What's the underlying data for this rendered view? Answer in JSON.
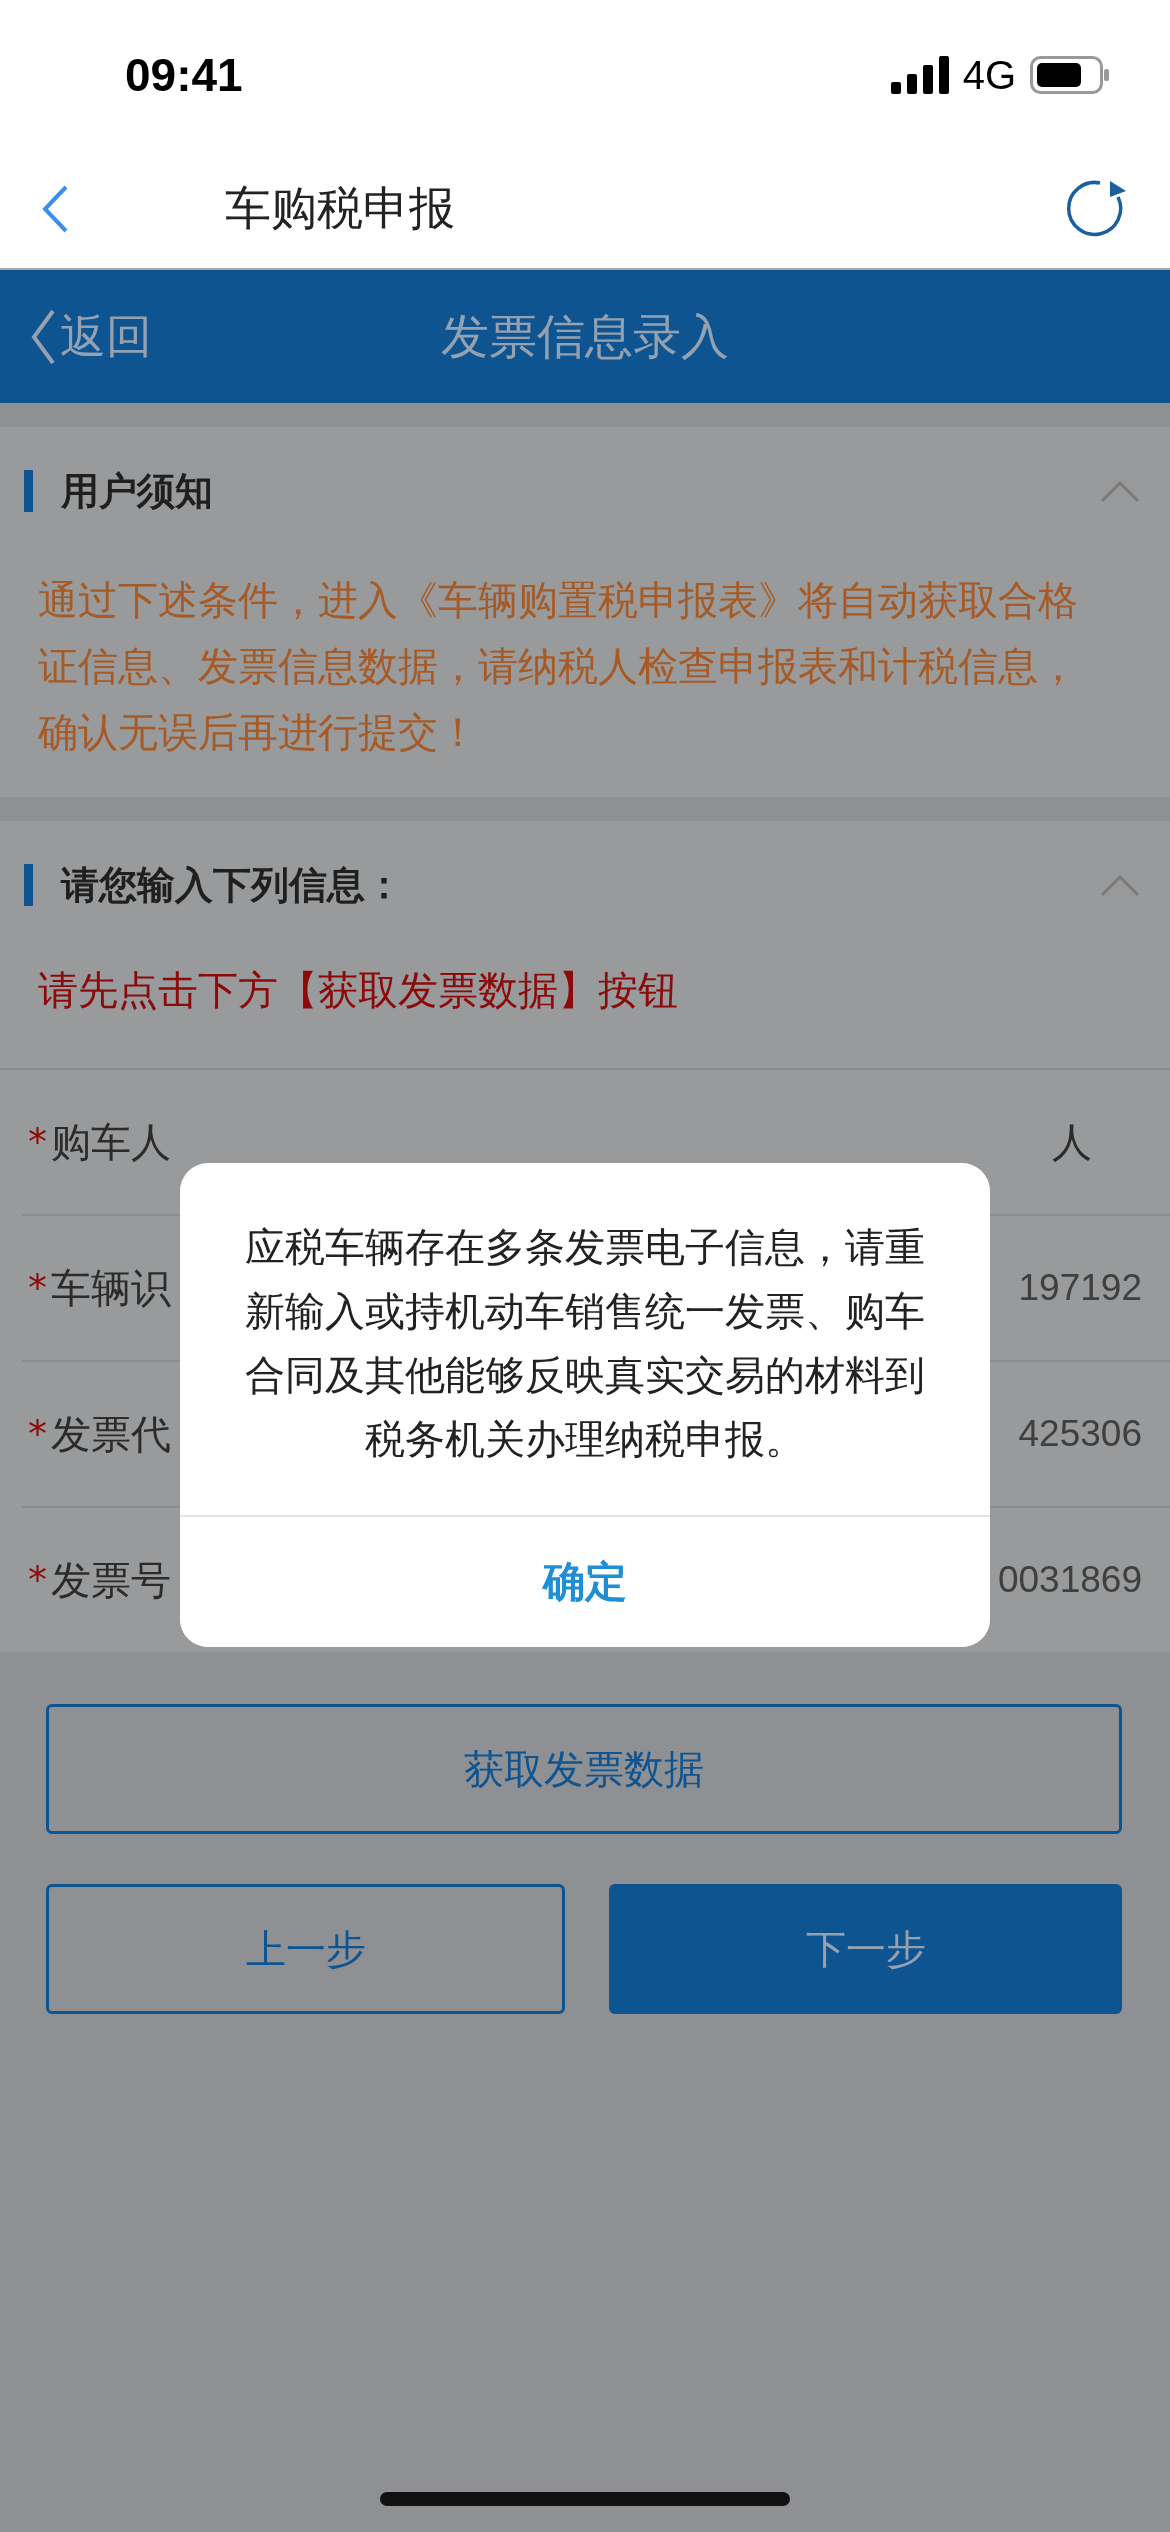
{
  "status_bar": {
    "time": "09:41",
    "network": "4G"
  },
  "nav_bar": {
    "title": "车购税申报"
  },
  "header": {
    "back": "返回",
    "title": "发票信息录入"
  },
  "notice": {
    "title": "用户须知",
    "expanded": true,
    "text": "通过下述条件，进入《车辆购置税申报表》将自动获取合格证信息、发票信息数据，请纳税人检查申报表和计税信息，确认无误后再进行提交！"
  },
  "form": {
    "title": "请您输入下列信息：",
    "expanded": true,
    "hint": "请先点击下方【获取发票数据】按钮",
    "rows": [
      {
        "mark": "*",
        "label": "购车人",
        "option": "人"
      },
      {
        "mark": "*",
        "label": "车辆识",
        "value": "197192"
      },
      {
        "mark": "*",
        "label": "发票代",
        "value": "425306"
      },
      {
        "mark": "*",
        "label": "发票号",
        "value": "0031869"
      }
    ]
  },
  "buttons": [
    {
      "kind": "outline",
      "label": "获取发票数据"
    },
    {
      "kind": "outline",
      "label": "上一步"
    },
    {
      "kind": "primary",
      "label": "下一步"
    }
  ],
  "dialog": {
    "message": "应税车辆存在多条发票电子信息，请重新输入或持机动车销售统一发票、购车合同及其他能够反映真实交易的材料到税务机关办理纳税申报。",
    "confirm": "确定"
  }
}
